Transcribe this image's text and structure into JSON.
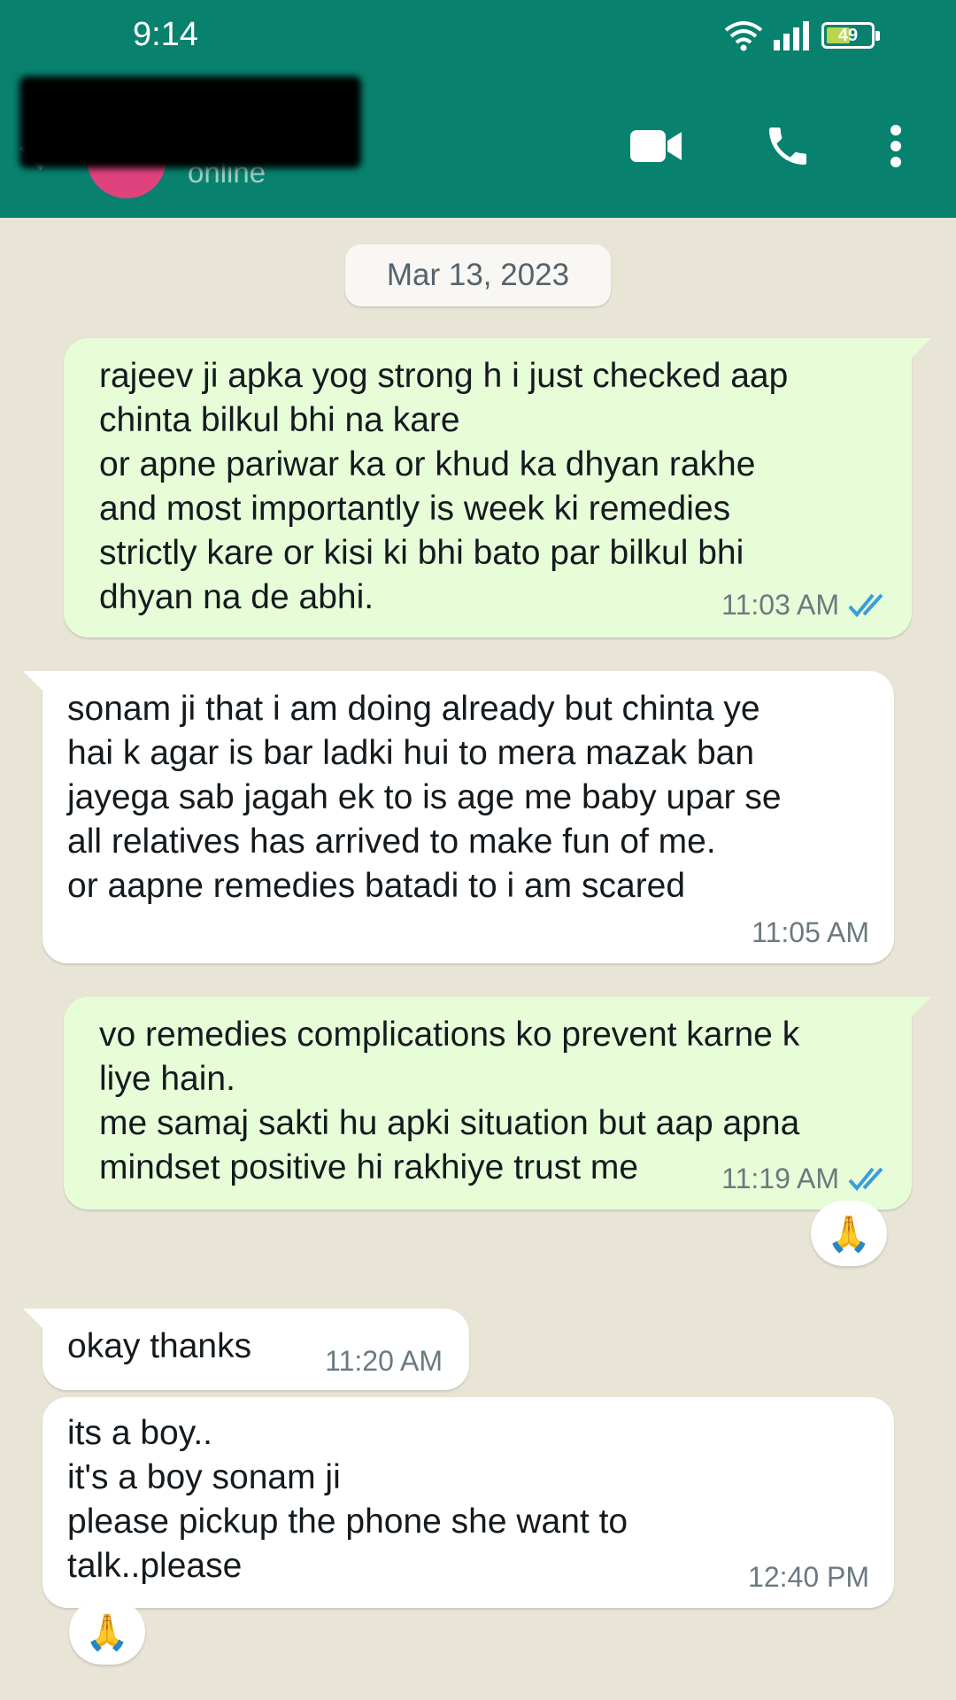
{
  "status_bar": {
    "time": "9:14",
    "battery": "49"
  },
  "contact": {
    "status": "online"
  },
  "date_chip": "Mar 13, 2023",
  "messages": [
    {
      "direction": "out",
      "text": "rajeev ji apka yog strong h i just checked aap\nchinta bilkul bhi na kare\nor apne pariwar ka or khud ka dhyan rakhe\nand most importantly is week ki remedies\nstrictly kare or kisi ki bhi bato par bilkul bhi\ndhyan na de abhi.",
      "time": "11:03 AM",
      "read": true
    },
    {
      "direction": "in",
      "text": "sonam ji that i am doing already but chinta ye\nhai k agar is bar ladki hui to mera mazak ban\njayega sab jagah ek to is age me baby upar se\nall relatives has arrived to make fun of me.\nor aapne remedies batadi to i am scared",
      "time": "11:05 AM"
    },
    {
      "direction": "out",
      "text": "vo remedies complications ko prevent karne k\nliye hain.\nme samaj sakti hu apki situation but aap apna\nmindset positive hi rakhiye trust me",
      "time": "11:19 AM",
      "read": true,
      "reaction": "🙏"
    },
    {
      "direction": "in",
      "text": "okay thanks",
      "time": "11:20 AM"
    },
    {
      "direction": "in",
      "text": "its a boy..\nit's a boy sonam ji\nplease pickup the phone she want to\ntalk..please",
      "time": "12:40 PM",
      "reaction": "🙏"
    }
  ],
  "colors": {
    "header": "#08826f",
    "outgoing": "#e7fdd8",
    "incoming": "#ffffff",
    "read_ticks": "#3a9edb"
  },
  "icons": [
    "back-arrow-icon",
    "video-call-icon",
    "phone-icon",
    "more-vert-icon",
    "wifi-icon",
    "signal-icon",
    "battery-icon",
    "double-check-icon"
  ]
}
